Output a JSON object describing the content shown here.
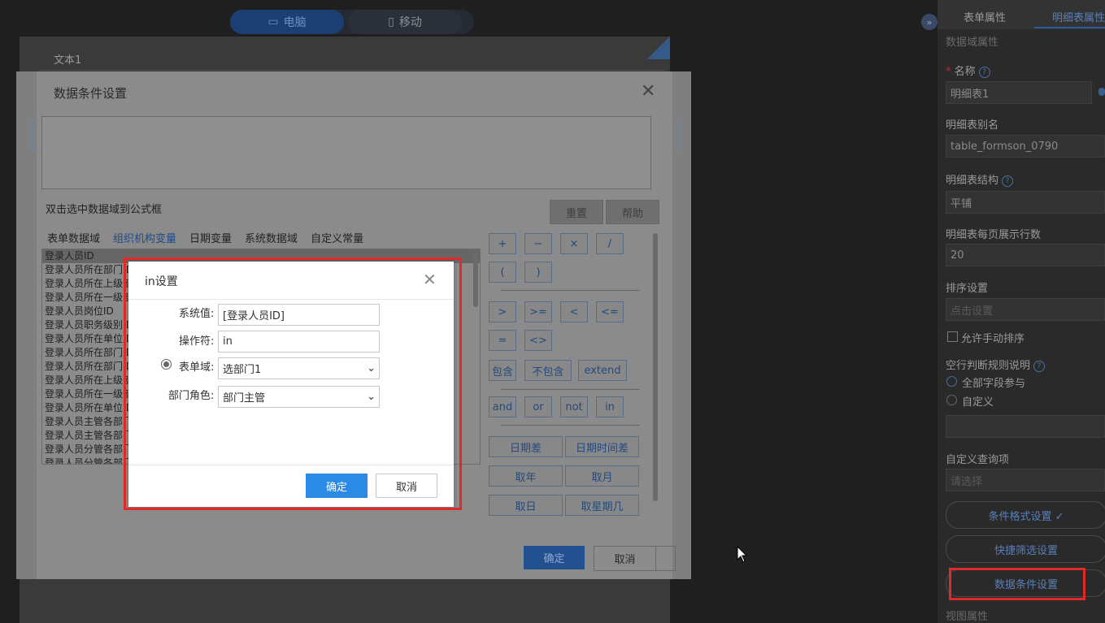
{
  "device_toggle": {
    "pc": "电脑",
    "mobile": "移动"
  },
  "canvas": {
    "field_label": "文本1"
  },
  "main_dialog": {
    "title": "数据条件设置",
    "hint": "双击选中数据域到公式框",
    "reset": "重置",
    "help": "帮助",
    "tabs": [
      "表单数据域",
      "组织机构变量",
      "日期变量",
      "系统数据域",
      "自定义常量"
    ],
    "active_tab": "组织机构变量",
    "list_items": [
      "登录人员ID",
      "登录人员所在部门 D",
      "登录人员所在上级部",
      "登录人员所在一级部",
      "登录人员岗位ID",
      "登录人员职务级别 D",
      "登录人员所在单位 D",
      "登录人员所在部门 D",
      "登录人员所在部门 D",
      "登录人员所在上级部",
      "登录人员所在一级部",
      "登录人员所在单位 D",
      "登录人员主管各部门",
      "登录人员主管各部门",
      "登录人员分管各部门",
      "登录人员分管各部门"
    ],
    "ops_row1": [
      "+",
      "−",
      "×",
      "/"
    ],
    "ops_row2": [
      "(",
      ")"
    ],
    "ops_row3": [
      ">",
      ">=",
      "<",
      "<="
    ],
    "ops_row4": [
      "=",
      "<>"
    ],
    "ops_row5": [
      "包含",
      "不包含",
      "extend"
    ],
    "ops_row6": [
      "and",
      "or",
      "not",
      "in"
    ],
    "func_row1": [
      "日期差",
      "日期时间差"
    ],
    "func_row2": [
      "取年",
      "取月"
    ],
    "func_row3": [
      "取日",
      "取星期几"
    ],
    "ok": "确定",
    "cancel": "取消"
  },
  "in_dialog": {
    "title": "in设置",
    "system_value_label": "系统值:",
    "system_value": "[登录人员ID]",
    "operator_label": "操作符:",
    "operator": "in",
    "form_field_label": "表单域:",
    "form_field": "选部门1",
    "dept_role_label": "部门角色:",
    "dept_role": "部门主管",
    "ok": "确定",
    "cancel": "取消"
  },
  "right_panel": {
    "tab_form": "表单属性",
    "tab_detail": "明细表属性",
    "section_data_field": "数据域属性",
    "name_label": "名称",
    "name_value": "明细表1",
    "alias_label": "明细表别名",
    "alias_value": "table_formson_0790",
    "structure_label": "明细表结构",
    "structure_value": "平铺",
    "rows_label": "明细表每页展示行数",
    "rows_value": "20",
    "sort_label": "排序设置",
    "sort_placeholder": "点击设置",
    "manual_sort": "允许手动排序",
    "empty_rule_label": "空行判断规则说明",
    "rule_all": "全部字段参与",
    "rule_custom": "自定义",
    "custom_query_label": "自定义查询项",
    "custom_query_placeholder": "请选择",
    "btn_condition_format": "条件格式设置 ✓",
    "btn_quick_filter": "快捷筛选设置",
    "btn_data_condition": "数据条件设置",
    "view_section": "视图属性"
  },
  "colors": {
    "accent": "#2a8ae6",
    "highlight": "#e0292b"
  }
}
